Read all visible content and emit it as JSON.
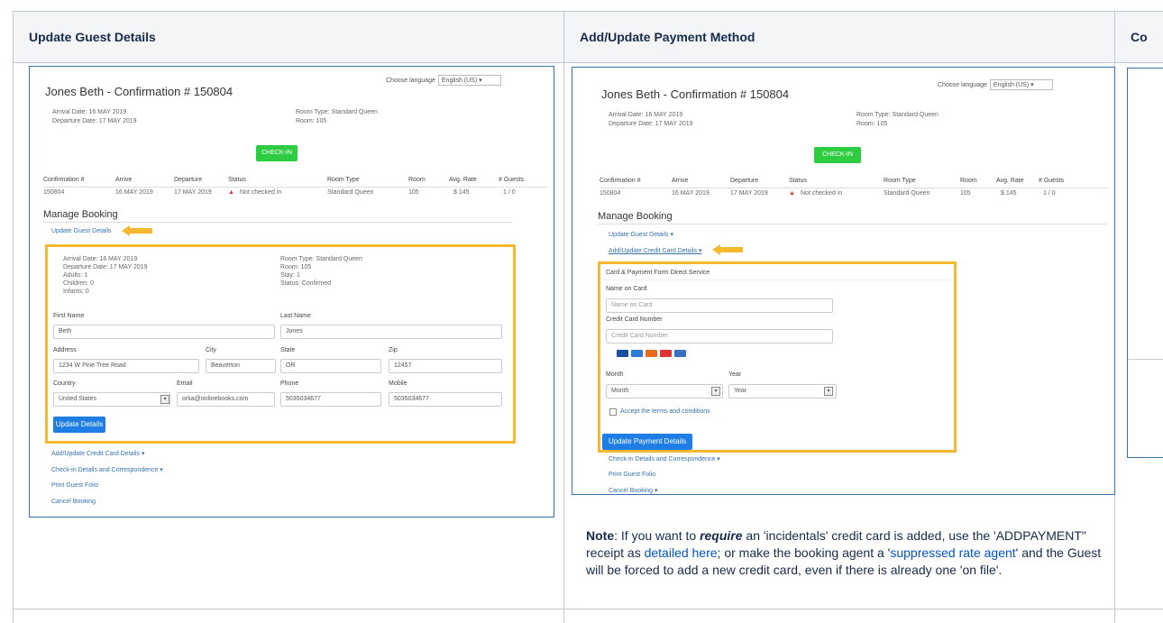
{
  "columns": [
    {
      "header": "Update Guest Details"
    },
    {
      "header": "Add/Update Payment Method"
    },
    {
      "header": "Co"
    }
  ],
  "shot1": {
    "lang_label": "Choose language",
    "lang_value": "English (US)",
    "title": "Jones Beth - Confirmation # 150804",
    "arrival": "Arrival Date: 16 MAY 2019",
    "departure": "Departure Date: 17 MAY 2019",
    "room_type": "Room Type: Standard Queen",
    "room": "Room: 105",
    "check_in": "CHECK-IN",
    "table_headers": [
      "Confirmation #",
      "Arrive",
      "Departure",
      "Status",
      "Room Type",
      "Room",
      "Avg. Rate",
      "# Guests"
    ],
    "table_row": [
      "150804",
      "16 MAY 2019",
      "17 MAY 2019",
      "Not checked in",
      "Standard Queen",
      "105",
      "$ 145",
      "1 / 0"
    ],
    "manage_booking": "Manage Booking",
    "link_update": "Update Guest Details",
    "details": [
      "Arrival Date: 16 MAY 2019",
      "Departure Date: 17 MAY 2019",
      "Adults: 1",
      "Children: 0",
      "Infants: 0"
    ],
    "details_right": [
      "Room Type: Standard Queen",
      "Room: 105",
      "Stay: 1",
      "Status: Confirmed"
    ],
    "first_name_label": "First Name",
    "first_name": "Beth",
    "last_name_label": "Last Name",
    "last_name": "Jones",
    "address_label": "Address",
    "address": "1234 W Pine Tree Road",
    "city_label": "City",
    "city": "Beaverton",
    "state_label": "State",
    "state": "OR",
    "zip_label": "Zip",
    "zip": "12457",
    "country_label": "Country",
    "country": "United States",
    "email_label": "Email",
    "email": "orka@onlinebooks.com",
    "phone_label": "Phone",
    "phone": "5035034677",
    "mobile_label": "Mobile",
    "mobile": "5035034677",
    "update_btn": "Update Details",
    "links": [
      "Add/Update Credit Card Details ▾",
      "Check-in Details and Correspondence ▾",
      "Print Guest Folio",
      "Cancel Booking"
    ]
  },
  "shot2": {
    "lang_label": "Choose language",
    "lang_value": "English (US)",
    "title": "Jones Beth - Confirmation # 150804",
    "arrival": "Arrival Date: 16 MAY 2019",
    "departure": "Departure Date: 17 MAY 2019",
    "room_type": "Room Type: Standard Queen",
    "room": "Room: 105",
    "check_in": "CHECK-IN",
    "table_headers": [
      "Confirmation #",
      "Arrive",
      "Departure",
      "Status",
      "Room Type",
      "Room",
      "Avg. Rate",
      "# Guests"
    ],
    "table_row": [
      "150804",
      "16 MAY 2019",
      "17 MAY 2019",
      "Not checked in",
      "Standard Queen",
      "105",
      "$ 145",
      "1 / 0"
    ],
    "manage_booking": "Manage Booking",
    "link_update": "Update Guest Details ▾",
    "link_payment": "Add/Update Credit Card Details ▾",
    "box_title": "Card & Payment Form Direct Service",
    "name_label": "Name on Card",
    "name_ph": "Name on Card",
    "cc_label": "Credit Card Number",
    "cc_ph": "Credit Card Number",
    "month_label": "Month",
    "month": "Month",
    "year_label": "Year",
    "year": "Year",
    "agree": "Accept the terms and conditions",
    "update_btn": "Update Payment Details",
    "links": [
      "Check-in Details and Correspondence ▾",
      "Print Guest Folio",
      "Cancel Booking ▾"
    ]
  },
  "note": {
    "bold": "Note",
    "p1": ": If you want to ",
    "emph": "require",
    "p2": " an 'incidentals' credit card is added, use the 'ADDPAYMENT\" receipt as ",
    "link1": "detailed here",
    "p3": "; or make the booking agent a '",
    "link2": "suppressed rate agent",
    "p4": "' and the Guest will be forced to add a new credit card, even if there is already one 'on file'."
  },
  "colors": {
    "accent": "#f5b82e",
    "link": "#0052cc",
    "green": "#2ecc40",
    "blue": "#1e7ee6"
  }
}
